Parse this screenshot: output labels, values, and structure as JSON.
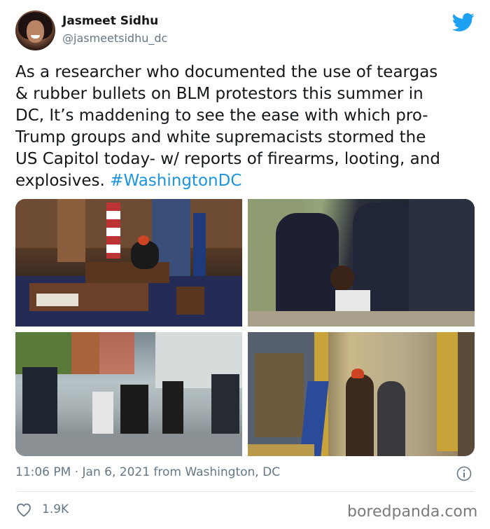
{
  "author": {
    "name": "Jasmeet Sidhu",
    "handle": "@jasmeetsidhu_dc"
  },
  "tweet": {
    "lines": [
      "As a researcher who documented the use of teargas",
      "& rubber bullets on BLM protestors this summer in",
      "DC, It’s maddening to see the ease with which pro-",
      "Trump groups and white supremacists stormed the",
      "US Capitol today- w/ reports of firearms, looting, and"
    ],
    "last_line_text": "explosives. ",
    "hashtag": "#WashingtonDC"
  },
  "footer": {
    "timestamp": "11:06 PM · Jan 6, 2021 from Washington, DC",
    "likes": "1.9K"
  },
  "watermark": "boredpanda.com",
  "colors": {
    "link": "#1b95e0",
    "twitter_blue": "#1da1f2",
    "secondary_text": "#657786"
  },
  "icons": [
    "twitter-bird-icon",
    "info-icon",
    "heart-icon"
  ]
}
